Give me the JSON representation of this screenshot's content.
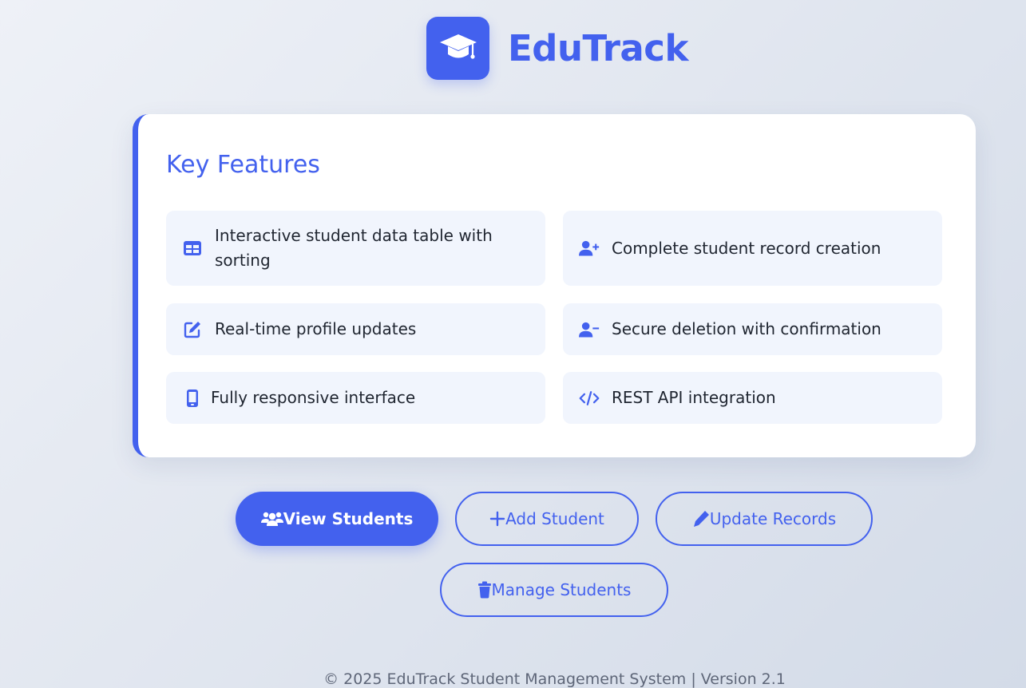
{
  "brand": {
    "name": "EduTrack",
    "logo_icon": "graduation-cap-icon",
    "accent_color": "#4361ee"
  },
  "features": {
    "title": "Key Features",
    "items": [
      {
        "label": "Interactive student data table with sorting",
        "icon": "table-icon"
      },
      {
        "label": "Complete student record creation",
        "icon": "user-plus-icon"
      },
      {
        "label": "Real-time profile updates",
        "icon": "edit-icon"
      },
      {
        "label": "Secure deletion with confirmation",
        "icon": "user-minus-icon"
      },
      {
        "label": "Fully responsive interface",
        "icon": "mobile-icon"
      },
      {
        "label": "REST API integration",
        "icon": "code-icon"
      }
    ]
  },
  "actions": {
    "view": {
      "label": "View Students",
      "icon": "users-icon"
    },
    "add": {
      "label": "Add Student",
      "icon": "plus-icon"
    },
    "update": {
      "label": "Update Records",
      "icon": "pen-icon"
    },
    "manage": {
      "label": "Manage Students",
      "icon": "trash-icon"
    }
  },
  "footer": {
    "text": "© 2025 EduTrack Student Management System | Version 2.1"
  }
}
